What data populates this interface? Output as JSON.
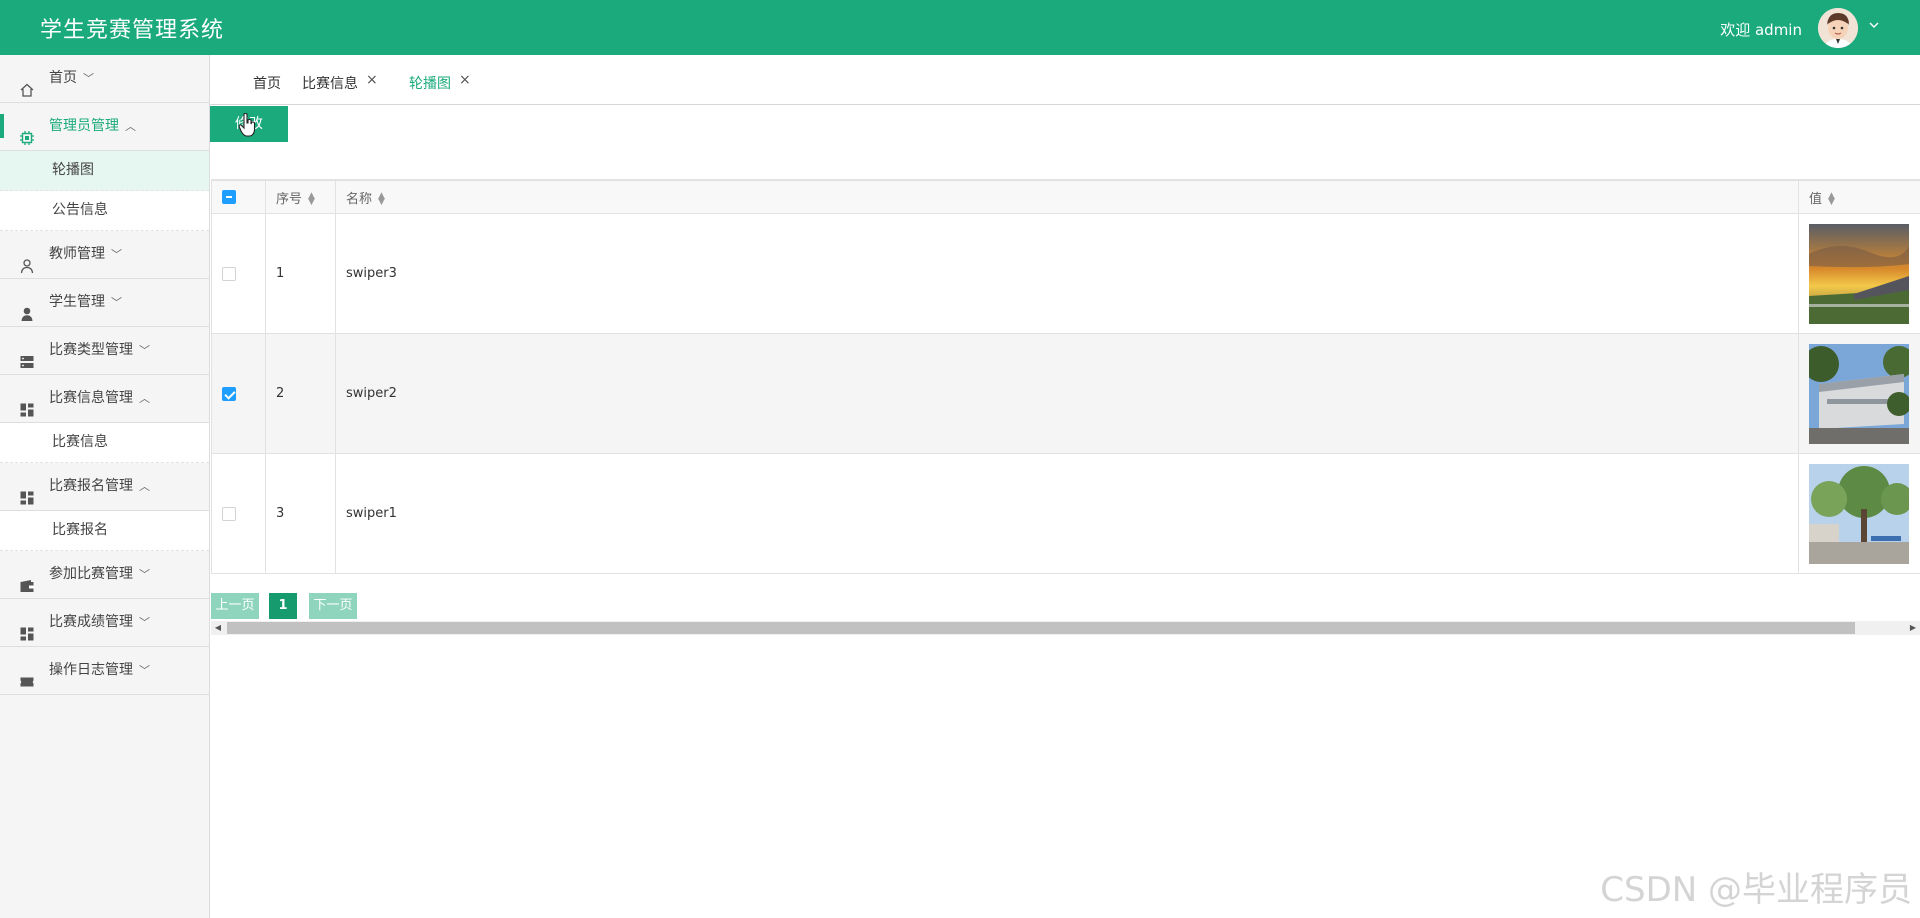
{
  "header": {
    "app_title": "学生竞赛管理系统",
    "welcome": "欢迎 admin",
    "avatar_icon": "user-avatar",
    "user_menu_icon": "chevron-down-icon",
    "brand_color": "#1aaa7c"
  },
  "sidebar": {
    "menus": [
      {
        "key": "home",
        "label": "首页",
        "chevron": "﹀",
        "icon": "home-icon"
      },
      {
        "key": "admin",
        "label": "管理员管理",
        "chevron": "︿",
        "icon": "chip-icon",
        "active": true,
        "children": [
          {
            "label": "轮播图",
            "selected": true
          },
          {
            "label": "公告信息"
          }
        ]
      },
      {
        "key": "teacher",
        "label": "教师管理",
        "chevron": "﹀",
        "icon": "person-outline-icon"
      },
      {
        "key": "student",
        "label": "学生管理",
        "chevron": "﹀",
        "icon": "person-icon"
      },
      {
        "key": "contest_type",
        "label": "比赛类型管理",
        "chevron": "﹀",
        "icon": "server-icon"
      },
      {
        "key": "contest_info",
        "label": "比赛信息管理",
        "chevron": "︿",
        "icon": "dashboard-icon",
        "children": [
          {
            "label": "比赛信息"
          }
        ]
      },
      {
        "key": "contest_signup",
        "label": "比赛报名管理",
        "chevron": "︿",
        "icon": "dashboard-icon",
        "children": [
          {
            "label": "比赛报名"
          }
        ]
      },
      {
        "key": "join_contest",
        "label": "参加比赛管理",
        "chevron": "﹀",
        "icon": "wallet-icon"
      },
      {
        "key": "contest_score",
        "label": "比赛成绩管理",
        "chevron": "﹀",
        "icon": "dashboard-icon"
      },
      {
        "key": "oplog",
        "label": "操作日志管理",
        "chevron": "﹀",
        "icon": "ticket-icon"
      }
    ]
  },
  "tabs": [
    {
      "label": "首页",
      "closable": false
    },
    {
      "label": "比赛信息",
      "closable": true
    },
    {
      "label": "轮播图",
      "closable": true,
      "active": true
    }
  ],
  "toolbar": {
    "edit_label": "修改"
  },
  "table": {
    "columns": {
      "index": "序号",
      "name": "名称",
      "value": "值"
    },
    "rows": [
      {
        "index": "1",
        "name": "swiper3",
        "checked": false,
        "image": "sunset-field-photo"
      },
      {
        "index": "2",
        "name": "swiper2",
        "checked": true,
        "image": "campus-building-photo"
      },
      {
        "index": "3",
        "name": "swiper1",
        "checked": false,
        "image": "campus-trees-photo"
      }
    ]
  },
  "pager": {
    "prev": "上一页",
    "current": "1",
    "next": "下一页"
  },
  "watermark": "CSDN @毕业程序员"
}
